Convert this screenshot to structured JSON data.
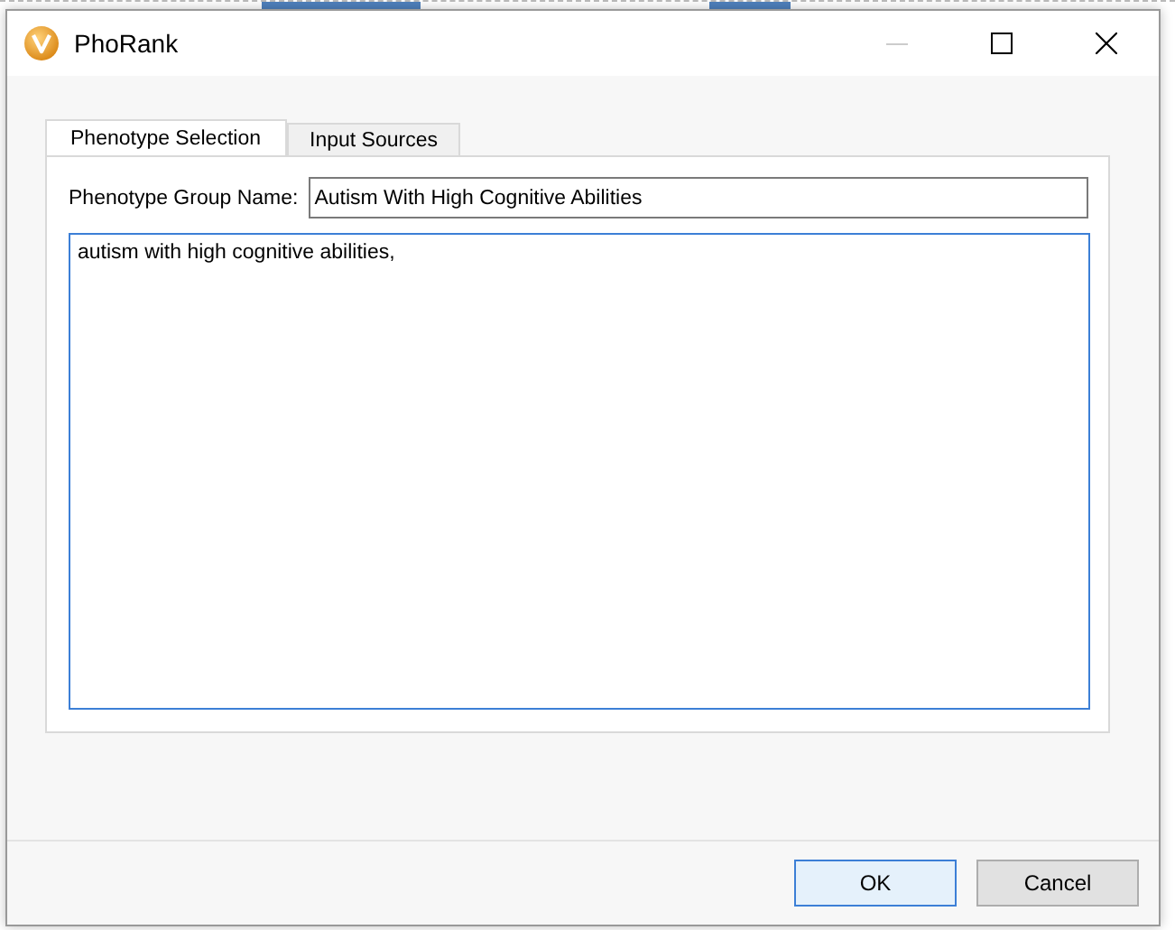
{
  "window": {
    "title": "PhoRank",
    "minimize_disabled": true
  },
  "tabs": [
    {
      "label": "Phenotype Selection",
      "selected": true
    },
    {
      "label": "Input Sources",
      "selected": false
    }
  ],
  "group_name": {
    "label": "Phenotype Group Name:",
    "value": "Autism With High Cognitive Abilities"
  },
  "terms": {
    "value": "autism with high cognitive abilities, "
  },
  "buttons": [
    {
      "label": "OK",
      "default": true
    },
    {
      "label": "Cancel",
      "default": false
    }
  ]
}
